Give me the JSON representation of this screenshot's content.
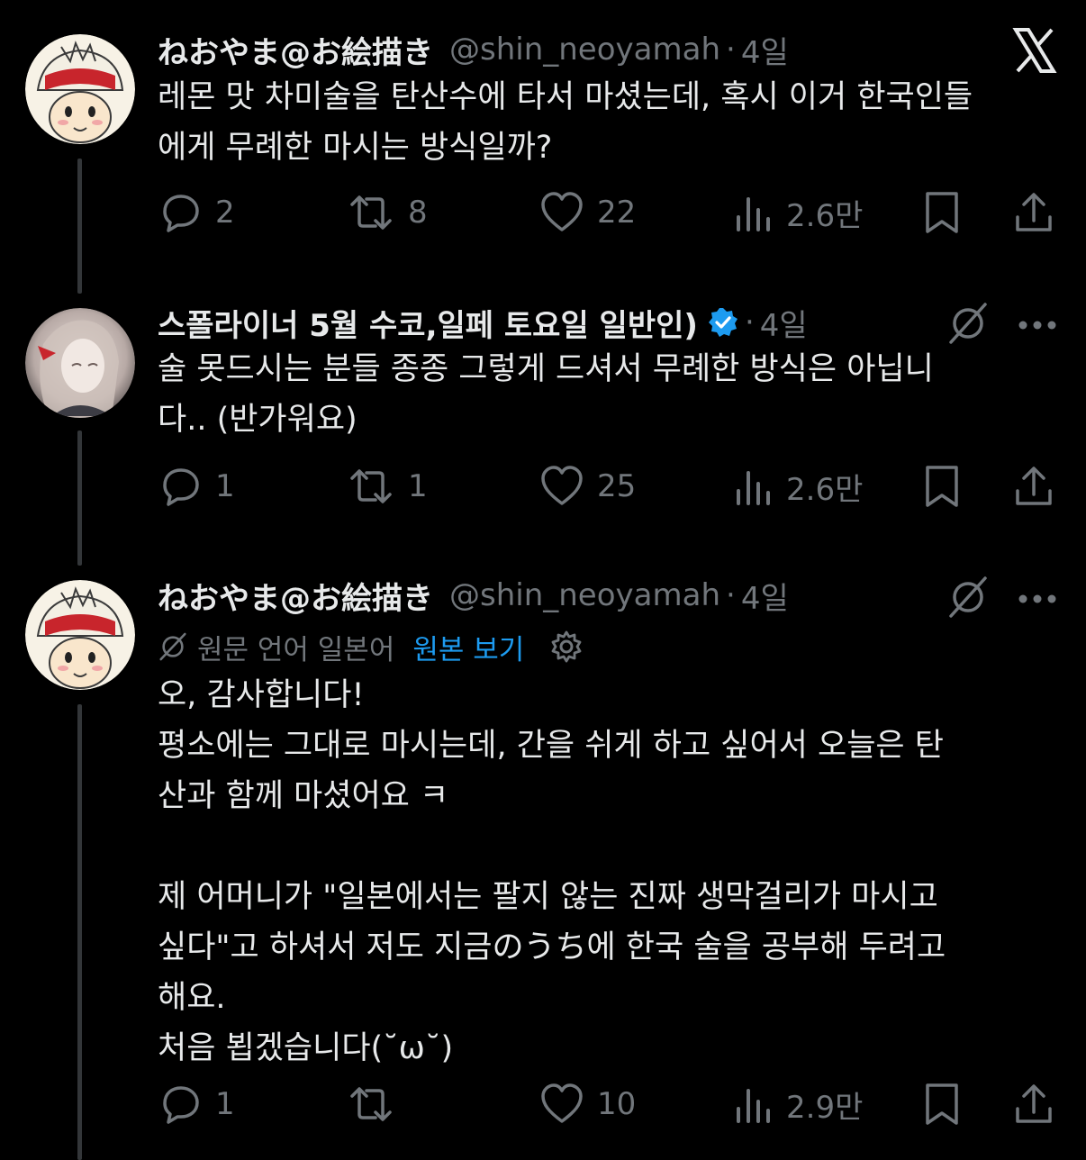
{
  "tweets": [
    {
      "name": "ねおやま@お絵描き",
      "handle": "@shin_neoyamah",
      "separator": "·",
      "time": "4일",
      "text": "레몬 맛 차미술을 탄산수에 타서 마셨는데, 혹시 이거 한국인들\n에게 무례한 마시는 방식일까?",
      "replies": "2",
      "reposts": "8",
      "likes": "22",
      "views": "2.6만"
    },
    {
      "name": "스폴라이너 5월 수코,일페 토요일 일반인)",
      "verified": true,
      "separator": "·",
      "time": "4일",
      "text": "술 못드시는 분들 종종 그렇게 드셔서 무례한 방식은 아닙니\n다.. (반가워요)",
      "replies": "1",
      "reposts": "1",
      "likes": "25",
      "views": "2.6만"
    },
    {
      "name": "ねおやま@お絵描き",
      "handle": "@shin_neoyamah",
      "separator": "·",
      "time": "4일",
      "translation_label": "원문 언어 일본어",
      "show_original": "원본 보기",
      "text": "오, 감사합니다!\n평소에는 그대로 마시는데, 간을 쉬게 하고 싶어서 오늘은 탄\n산과 함께 마셨어요 ㅋ\n\n제 어머니가 \"일본에서는 팔지 않는 진짜 생막걸리가 마시고\n싶다\"고 하셔서 저도 지금のうち에 한국 술을 공부해 두려고\n해요.\n처음 뵙겠습니다(˘ω˘)",
      "replies": "1",
      "reposts": "",
      "likes": "10",
      "views": "2.9만"
    }
  ],
  "colors": {
    "background": "#000000",
    "text": "#e7e9ea",
    "muted": "#71767b",
    "accent": "#1d9bf0",
    "thread_line": "#333639"
  },
  "icons": [
    "x-logo-icon",
    "reply-icon",
    "repost-icon",
    "like-icon",
    "views-icon",
    "bookmark-icon",
    "share-icon",
    "grok-icon",
    "more-icon",
    "translate-icon",
    "gear-icon",
    "verified-badge-icon"
  ]
}
